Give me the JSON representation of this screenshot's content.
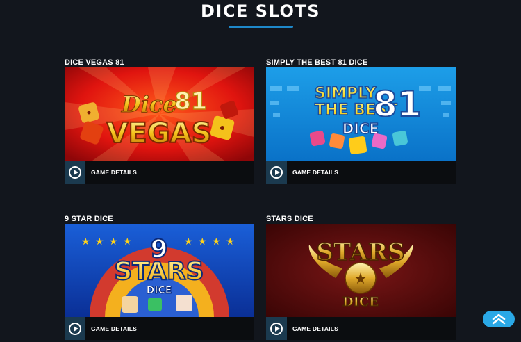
{
  "page": {
    "title": "DICE SLOTS"
  },
  "games": [
    {
      "name": "DICE VEGAS 81",
      "logo_script": "Dice",
      "logo_number": "81",
      "logo_main": "VEGAS",
      "details_label": "GAME DETAILS"
    },
    {
      "name": "SIMPLY THE BEST 81 DICE",
      "logo_line1": "SIMPLY",
      "logo_line2": "THE BEST",
      "logo_number": "81",
      "logo_sub": "DICE",
      "details_label": "GAME DETAILS"
    },
    {
      "name": "9 STAR DICE",
      "logo_number": "9",
      "logo_main": "STARS",
      "logo_sub": "DICE",
      "details_label": "GAME DETAILS"
    },
    {
      "name": "STARS DICE",
      "logo_main": "STARS",
      "logo_sub": "DICE",
      "details_label": "GAME DETAILS"
    }
  ],
  "colors": {
    "accent": "#1e88c9",
    "scroll_button": "#2aa8e6",
    "background": "#12161d"
  },
  "icons": {
    "play": "play-circle-icon",
    "scroll_top": "double-chevron-up-icon"
  }
}
